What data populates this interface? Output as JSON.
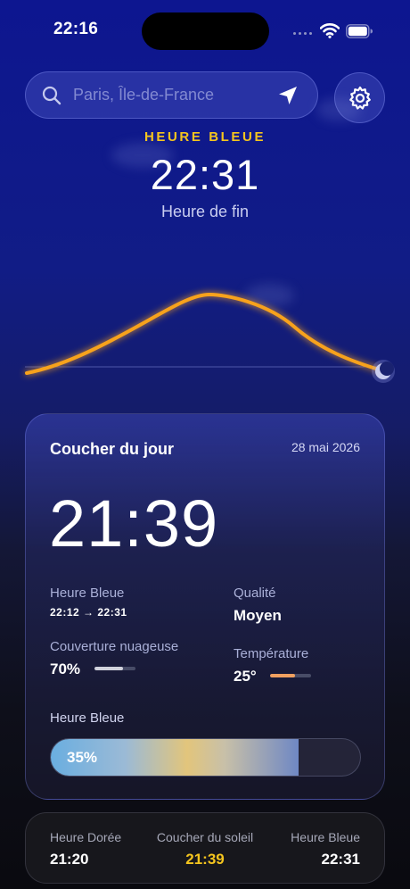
{
  "status_bar": {
    "time": "22:16"
  },
  "search": {
    "placeholder": "Paris, Île-de-France"
  },
  "phase": {
    "label": "HEURE BLEUE",
    "time": "22:31",
    "subtitle": "Heure de fin"
  },
  "card": {
    "title": "Coucher du jour",
    "date": "28 mai 2026",
    "sunset_time": "21:39",
    "blue_hour": {
      "label": "Heure Bleue",
      "value": "22:12 → 22:31"
    },
    "quality": {
      "label": "Qualité",
      "value": "Moyen"
    },
    "cloud_cover": {
      "label": "Couverture nuageuse",
      "value": "70%",
      "fraction": 0.7
    },
    "temperature": {
      "label": "Température",
      "value": "25°",
      "fraction": 0.6
    },
    "progress": {
      "label": "Heure Bleue",
      "value": "35%",
      "fraction": 0.8
    }
  },
  "bottom": {
    "golden": {
      "label": "Heure Dorée",
      "value": "21:20"
    },
    "sunset": {
      "label": "Coucher du soleil",
      "value": "21:39"
    },
    "blue": {
      "label": "Heure Bleue",
      "value": "22:31"
    }
  },
  "colors": {
    "accent_yellow": "#f5c51e",
    "temperature_orange": "#f0a060",
    "curve_orange": "#f7a21c"
  },
  "icons": [
    "search-icon",
    "location-arrow-icon",
    "gear-icon",
    "signal-icon",
    "wifi-icon",
    "battery-icon",
    "moon-icon"
  ]
}
